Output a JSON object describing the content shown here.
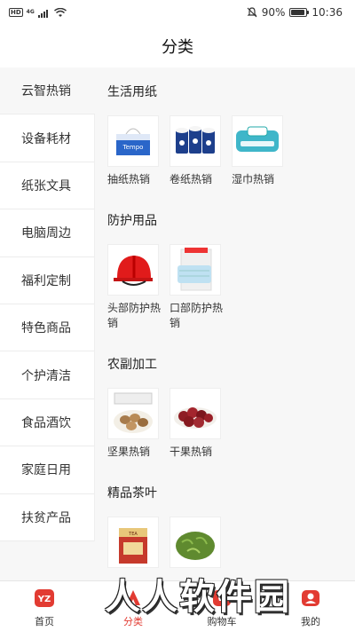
{
  "status_bar": {
    "hd": "HD",
    "network_top": "4G",
    "network_bottom": "",
    "battery_percent": "90%",
    "battery_level": 0.9,
    "time": "10:36"
  },
  "header": {
    "title": "分类"
  },
  "sidebar": {
    "items": [
      {
        "label": "云智热销",
        "active": true
      },
      {
        "label": "设备耗材"
      },
      {
        "label": "纸张文具"
      },
      {
        "label": "电脑周边"
      },
      {
        "label": "福利定制"
      },
      {
        "label": "特色商品"
      },
      {
        "label": "个护清洁"
      },
      {
        "label": "食品酒饮"
      },
      {
        "label": "家庭日用"
      },
      {
        "label": "扶贫产品"
      }
    ]
  },
  "content": {
    "sections": [
      {
        "title": "生活用纸",
        "items": [
          {
            "label": "抽纸热销",
            "icon": "tissue-box-icon"
          },
          {
            "label": "卷纸热销",
            "icon": "toilet-roll-icon"
          },
          {
            "label": "湿巾热销",
            "icon": "wet-wipes-icon"
          }
        ]
      },
      {
        "title": "防护用品",
        "items": [
          {
            "label": "头部防护热销",
            "icon": "hard-hat-icon"
          },
          {
            "label": "口部防护热销",
            "icon": "face-mask-icon"
          }
        ]
      },
      {
        "title": "农副加工",
        "items": [
          {
            "label": "坚果热销",
            "icon": "nuts-icon"
          },
          {
            "label": "干果热销",
            "icon": "dried-fruit-icon"
          }
        ]
      },
      {
        "title": "精品茶叶",
        "items": [
          {
            "label": "",
            "icon": "tea-box-icon"
          },
          {
            "label": "",
            "icon": "green-tea-icon"
          }
        ]
      }
    ]
  },
  "tabbar": {
    "tabs": [
      {
        "label": "首页",
        "icon": "home-logo-icon"
      },
      {
        "label": "分类",
        "icon": "category-icon",
        "active": true
      },
      {
        "label": "购物车",
        "icon": "cart-icon"
      },
      {
        "label": "我的",
        "icon": "profile-icon"
      }
    ]
  },
  "watermark": {
    "text": "人人软件园"
  },
  "colors": {
    "accent": "#e23b32",
    "sidebar_bg": "#f7f7f7"
  }
}
